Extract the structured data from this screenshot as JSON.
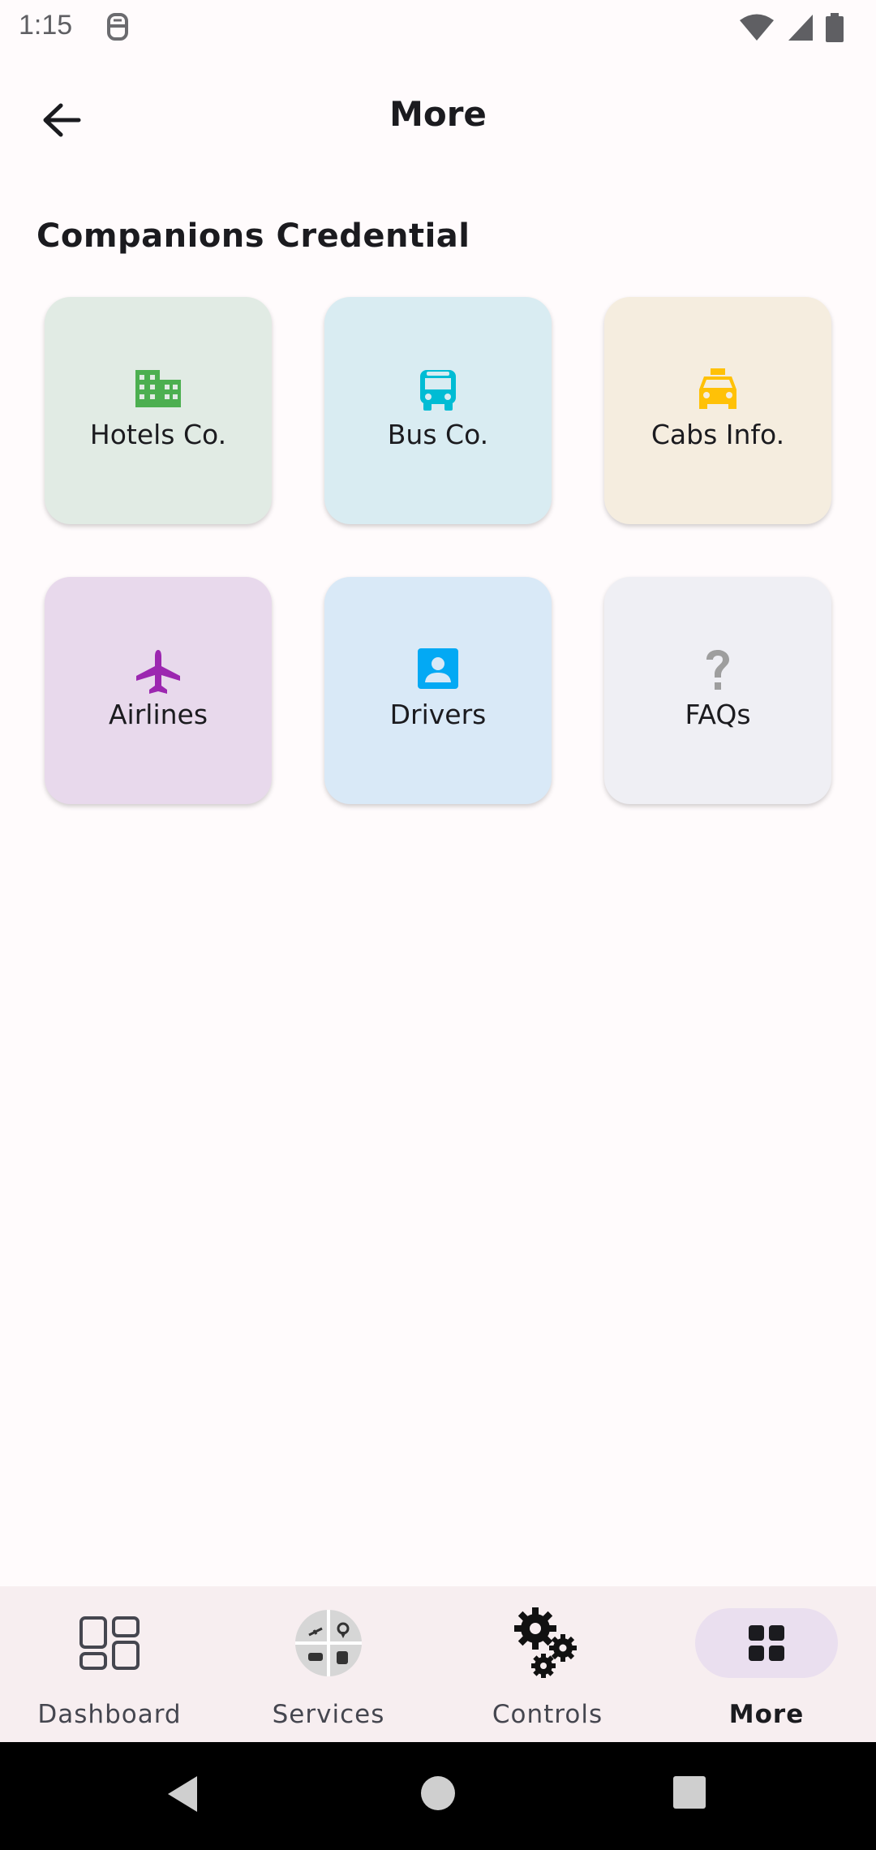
{
  "status_bar": {
    "time": "1:15"
  },
  "header": {
    "title": "More"
  },
  "section": {
    "title": "Companions Credential"
  },
  "cards": [
    {
      "label": "Hotels Co.",
      "icon": "building-icon",
      "bg": "#e1ebe4",
      "color": "#4caf50"
    },
    {
      "label": "Bus Co.",
      "icon": "bus-icon",
      "bg": "#d9ecf2",
      "color": "#00bcd4"
    },
    {
      "label": "Cabs Info.",
      "icon": "taxi-icon",
      "bg": "#f5eddf",
      "color": "#ffc107"
    },
    {
      "label": "Airlines",
      "icon": "airplane-icon",
      "bg": "#e8d9ec",
      "color": "#9c27b0"
    },
    {
      "label": "Drivers",
      "icon": "contact-card-icon",
      "bg": "#d9e9f7",
      "color": "#03a9f4"
    },
    {
      "label": "FAQs",
      "icon": "question-mark-icon",
      "bg": "#efeff4",
      "color": "#9e9e9e"
    }
  ],
  "bottom_nav": [
    {
      "label": "Dashboard",
      "icon": "dashboard-icon"
    },
    {
      "label": "Services",
      "icon": "services-icon"
    },
    {
      "label": "Controls",
      "icon": "gears-icon"
    },
    {
      "label": "More",
      "icon": "grid-icon",
      "active": true
    }
  ]
}
